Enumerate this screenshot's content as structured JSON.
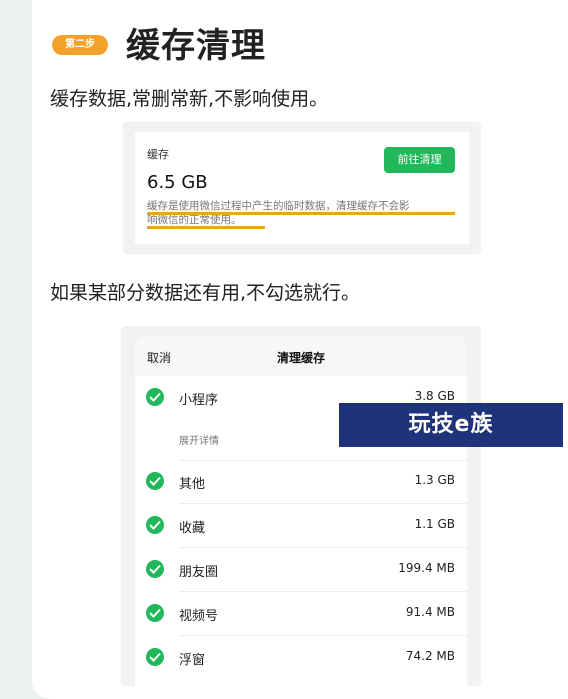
{
  "step_badge": "第二步",
  "title": "缓存清理",
  "para1": "缓存数据,常删常新,不影响使用。",
  "para2": "如果某部分数据还有用,不勾选就行。",
  "cache_card": {
    "label": "缓存",
    "size": "6.5 GB",
    "button": "前往清理",
    "desc_line1": "缓存是使用微信过程中产生的临时数据，清理缓存不会影",
    "desc_line2": "响微信的正常使用。",
    "highlight_color": "#f0a21c"
  },
  "sheet": {
    "cancel": "取消",
    "title": "清理缓存",
    "expand_details": "展开详情",
    "items": [
      {
        "name": "小程序",
        "size": "3.8 GB"
      },
      {
        "name": "其他",
        "size": "1.3 GB"
      },
      {
        "name": "收藏",
        "size": "1.1 GB"
      },
      {
        "name": "朋友圈",
        "size": "199.4 MB"
      },
      {
        "name": "视频号",
        "size": "91.4 MB"
      },
      {
        "name": "浮窗",
        "size": "74.2 MB"
      }
    ]
  },
  "watermark": "玩技e族",
  "colors": {
    "accent_green": "#22b75b",
    "badge_orange": "#f3a12a",
    "watermark_blue": "#1e3379"
  }
}
